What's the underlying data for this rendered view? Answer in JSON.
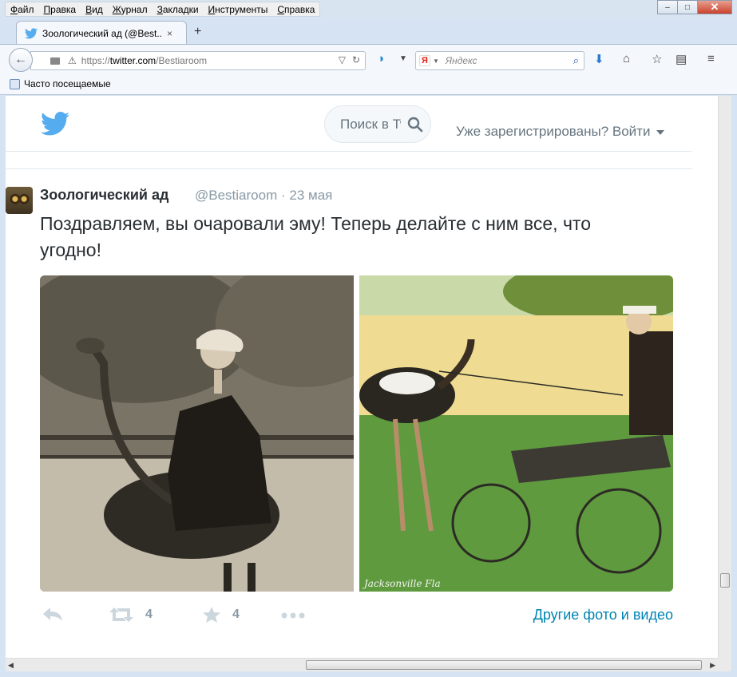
{
  "menu": [
    "Файл",
    "Правка",
    "Вид",
    "Журнал",
    "Закладки",
    "Инструменты",
    "Справка"
  ],
  "window_buttons": {
    "minimize": "–",
    "maximize": "□",
    "close": "✕"
  },
  "tab": {
    "title": "Зоологический ад (@Best...",
    "close": "×",
    "new_tab": "+"
  },
  "urlbar": {
    "scheme": "https://",
    "host": "twitter.com",
    "path": "/Bestiaroom"
  },
  "searchbar": {
    "engine": "Я",
    "placeholder": "Яндекс"
  },
  "bookmarks": {
    "item": "Часто посещаемые"
  },
  "twitter": {
    "search_placeholder": "Поиск в Twitter",
    "login_text": "Уже зарегистрированы? Войти",
    "tweet": {
      "name": "Зоологический ад",
      "handle": "@Bestiaroom",
      "separator": "·",
      "date": "23 мая",
      "text": "Поздравляем, вы очаровали эму! Теперь делайте с ним все, что угодно!",
      "retweets": "4",
      "favorites": "4",
      "more_media": "Другие фото и видео",
      "photo_caption_right": "Jacksonville Fla"
    }
  },
  "colors": {
    "twitter_blue": "#55acee",
    "link": "#0084b4",
    "muted": "#8899a6",
    "text": "#292f33"
  }
}
